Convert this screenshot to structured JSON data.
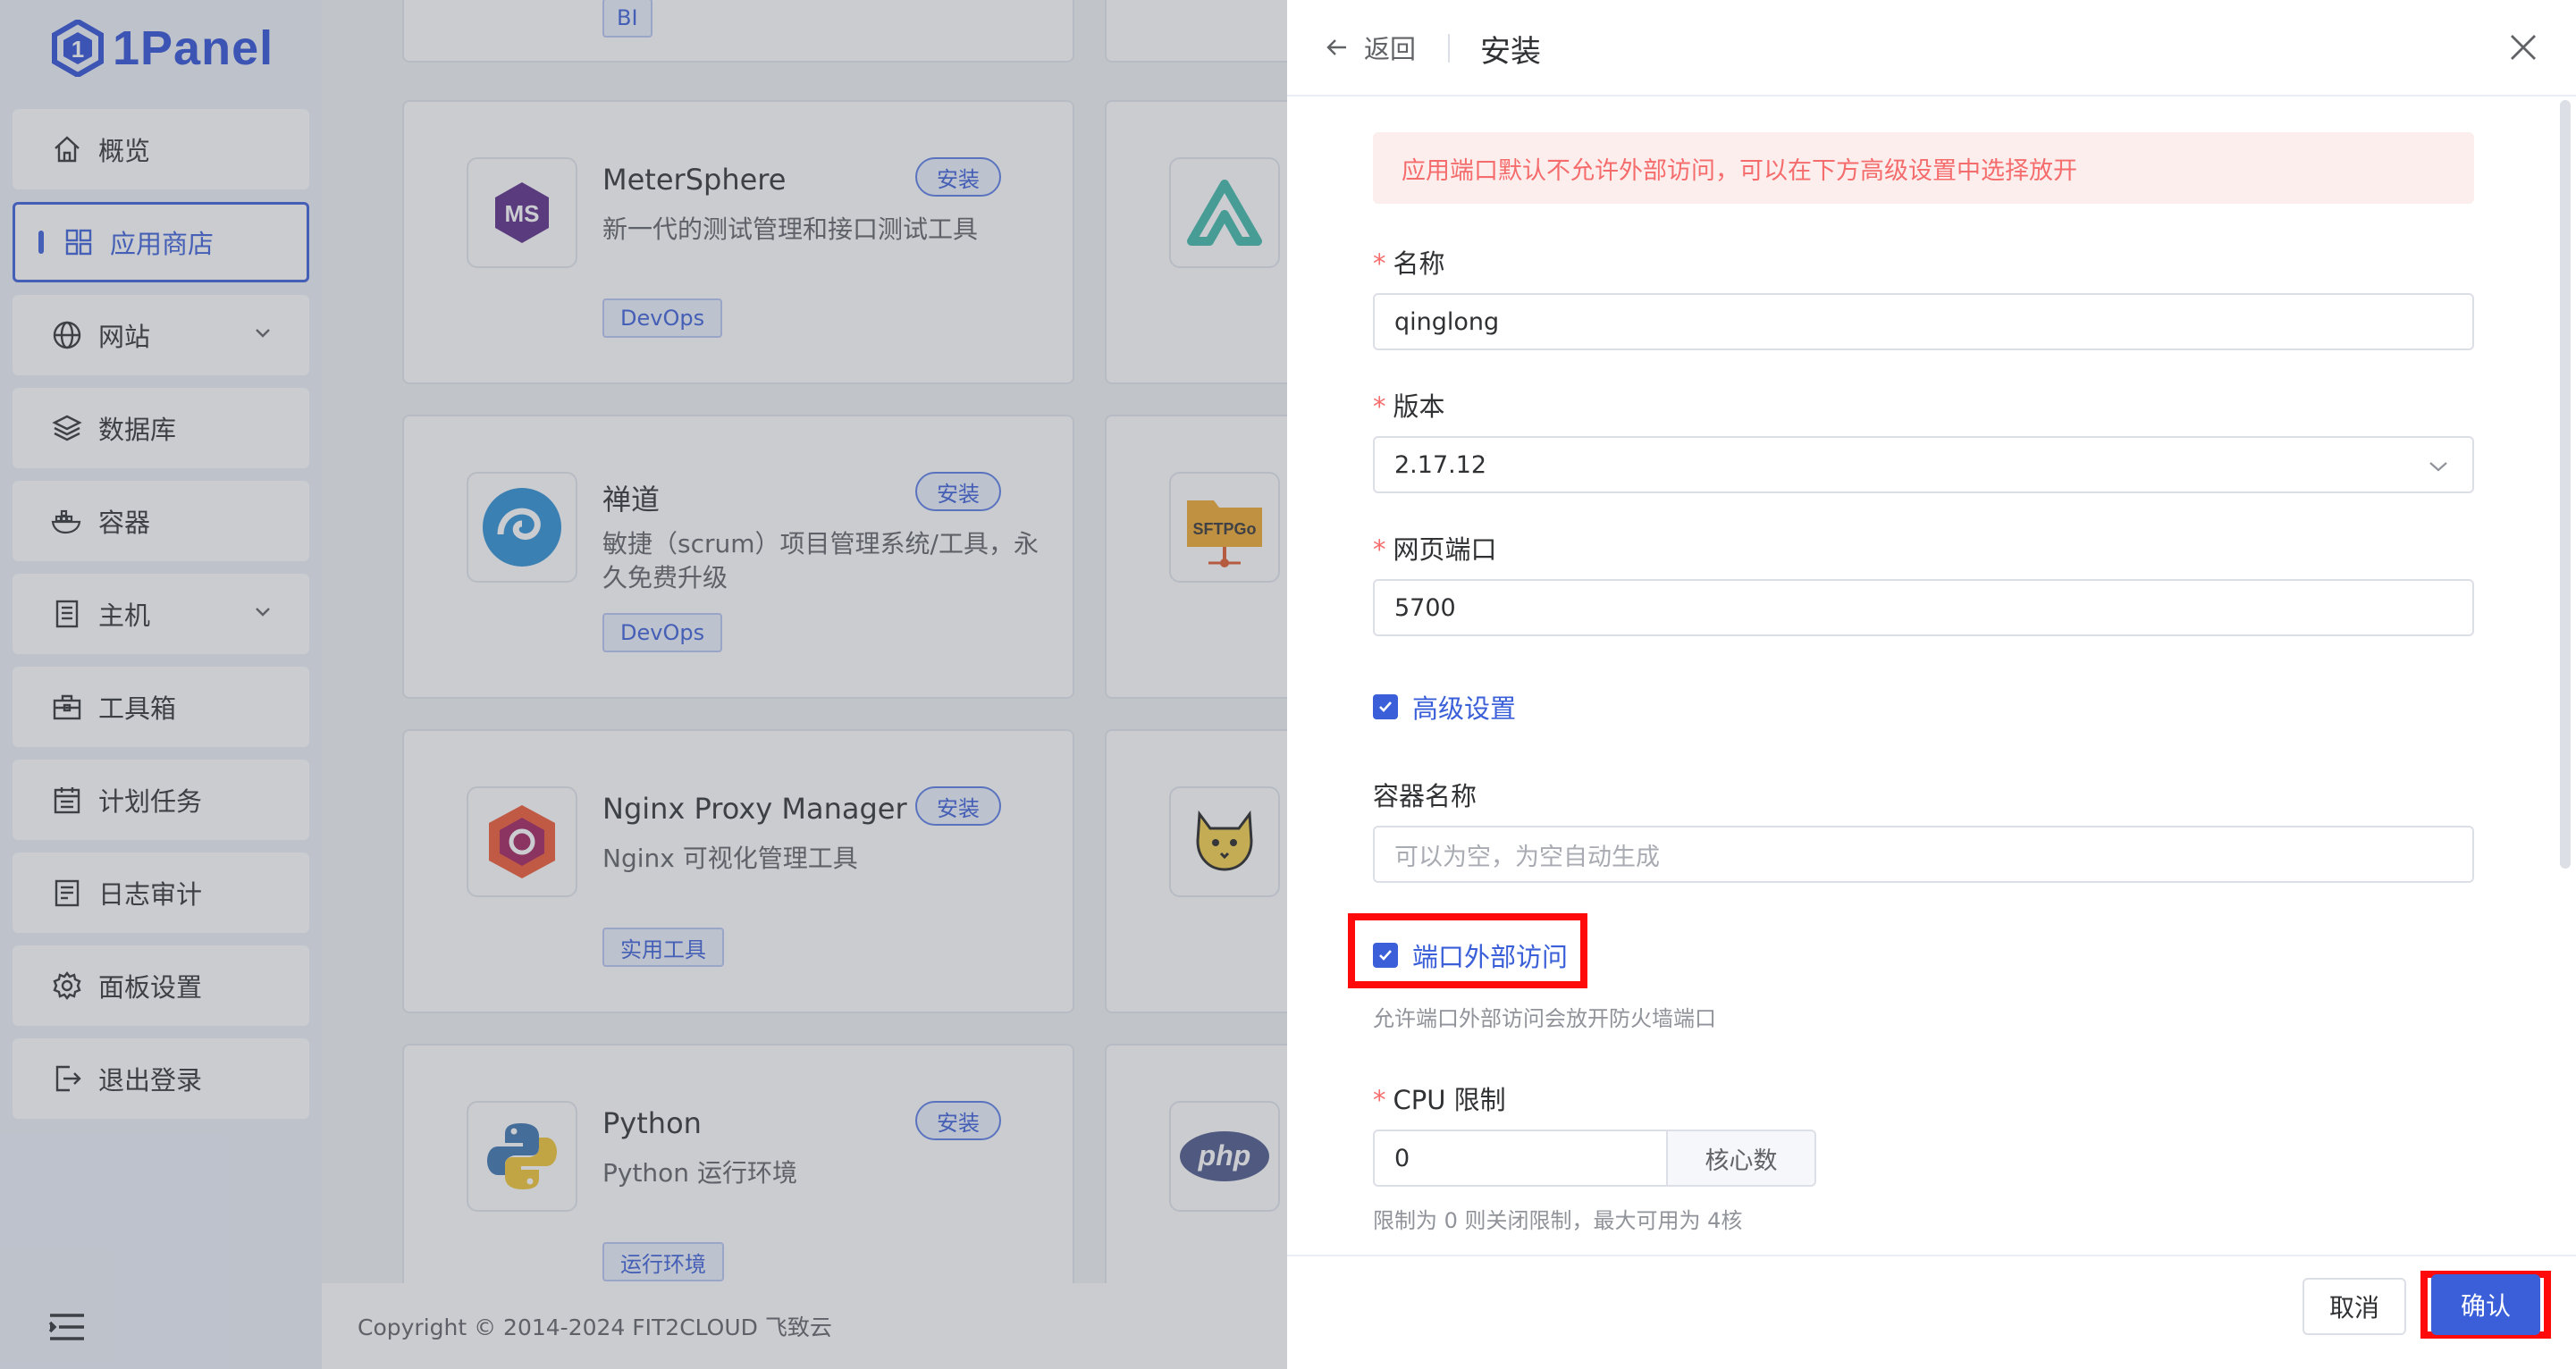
{
  "brand": {
    "name": "1Panel"
  },
  "sidebar": {
    "items": [
      {
        "label": "概览",
        "icon": "home-icon"
      },
      {
        "label": "应用商店",
        "icon": "apps-grid-icon",
        "active": true
      },
      {
        "label": "网站",
        "icon": "globe-icon",
        "expandable": true
      },
      {
        "label": "数据库",
        "icon": "layers-icon"
      },
      {
        "label": "容器",
        "icon": "docker-icon"
      },
      {
        "label": "主机",
        "icon": "server-icon",
        "expandable": true
      },
      {
        "label": "工具箱",
        "icon": "toolbox-icon"
      },
      {
        "label": "计划任务",
        "icon": "calendar-icon"
      },
      {
        "label": "日志审计",
        "icon": "log-icon"
      },
      {
        "label": "面板设置",
        "icon": "gear-icon"
      },
      {
        "label": "退出登录",
        "icon": "logout-icon"
      }
    ]
  },
  "footer": {
    "copyright": "Copyright © 2014-2024 FIT2CLOUD 飞致云"
  },
  "apps": {
    "top_tag": "BI",
    "cards": [
      {
        "name": "MeterSphere",
        "desc": "新一代的测试管理和接口测试工具",
        "tag": "DevOps",
        "button": "安装"
      },
      {
        "name": "禅道",
        "desc": "敏捷（scrum）项目管理系统/工具，永久免费升级",
        "tag": "DevOps",
        "button": "安装"
      },
      {
        "name": "Nginx Proxy Manager",
        "desc": "Nginx 可视化管理工具",
        "tag": "实用工具",
        "button": "安装"
      },
      {
        "name": "Python",
        "desc": "Python 运行环境",
        "tag": "运行环境",
        "button": "安装"
      }
    ],
    "side_icons": [
      "alist-icon",
      "sftpgo-icon",
      "tomcat-icon",
      "php-icon"
    ],
    "sftpgo_label": "SFTPGo",
    "php_label": "php"
  },
  "drawer": {
    "back_label": "返回",
    "title": "安装",
    "alert": "应用端口默认不允许外部访问，可以在下方高级设置中选择放开",
    "name_label": "名称",
    "name_value": "qinglong",
    "version_label": "版本",
    "version_value": "2.17.12",
    "port_label": "网页端口",
    "port_value": "5700",
    "advanced_label": "高级设置",
    "advanced_checked": true,
    "container_label": "容器名称",
    "container_placeholder": "可以为空，为空自动生成",
    "external_label": "端口外部访问",
    "external_checked": true,
    "external_hint": "允许端口外部访问会放开防火墙端口",
    "cpu_label": "CPU 限制",
    "cpu_value": "0",
    "cpu_unit": "核心数",
    "cpu_hint": "限制为 0 则关闭限制，最大可用为 4核",
    "cancel_label": "取消",
    "confirm_label": "确认"
  },
  "colors": {
    "primary": "#3a5fd8",
    "danger": "#f56c6c",
    "highlight": "#ff0a0a"
  }
}
